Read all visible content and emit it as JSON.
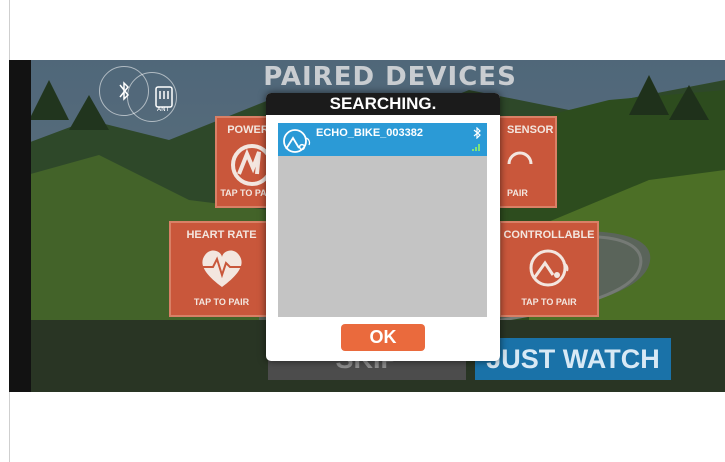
{
  "screen": {
    "title": "PAIRED DEVICES"
  },
  "protocols": [
    {
      "icon": "bluetooth-icon"
    },
    {
      "icon": "ant-plus-icon",
      "label": "ANT"
    }
  ],
  "tiles": [
    {
      "label": "POWER",
      "pair": "TAP TO PAIR",
      "icon": "power-meter-icon"
    },
    {
      "label": "SENSOR",
      "pair": "PAIR",
      "icon": "speed-sensor-icon"
    },
    {
      "label": "HEART RATE",
      "pair": "TAP TO PAIR",
      "icon": "heart-rate-icon"
    },
    {
      "label": "CONTROLLABLE",
      "pair": "TAP TO PAIR",
      "icon": "controllable-trainer-icon"
    }
  ],
  "buttons": {
    "skip": "SKIP",
    "just_watch": "JUST WATCH"
  },
  "modal": {
    "title": "SEARCHING.",
    "devices": [
      {
        "name": "ECHO_BIKE_003382",
        "icon": "trainer-device-icon",
        "connection": "bluetooth-icon",
        "signal": "signal-bars-icon"
      }
    ],
    "ok_label": "OK"
  }
}
